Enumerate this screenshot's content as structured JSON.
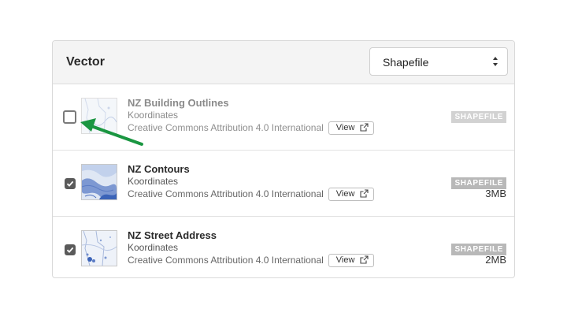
{
  "panel": {
    "title": "Vector",
    "format_select": {
      "value": "Shapefile"
    }
  },
  "rows": [
    {
      "title": "NZ Building Outlines",
      "publisher": "Koordinates",
      "license": "Creative Commons Attribution 4.0 International",
      "view_label": "View",
      "format_badge": "SHAPEFILE",
      "size": "",
      "checked": false
    },
    {
      "title": "NZ Contours",
      "publisher": "Koordinates",
      "license": "Creative Commons Attribution 4.0 International",
      "view_label": "View",
      "format_badge": "SHAPEFILE",
      "size": "3MB",
      "checked": true
    },
    {
      "title": "NZ Street Address",
      "publisher": "Koordinates",
      "license": "Creative Commons Attribution 4.0 International",
      "view_label": "View",
      "format_badge": "SHAPEFILE",
      "size": "2MB",
      "checked": true
    }
  ],
  "colors": {
    "annotation_arrow": "#1a9641",
    "badge": "#b8b8b8",
    "checkbox_checked": "#5a5a5a",
    "map_blue": "#3b63b8"
  },
  "icons": [
    "select-arrows-icon",
    "checkbox-check-icon",
    "external-link-icon",
    "map-thumbnail",
    "annotation-arrow"
  ]
}
